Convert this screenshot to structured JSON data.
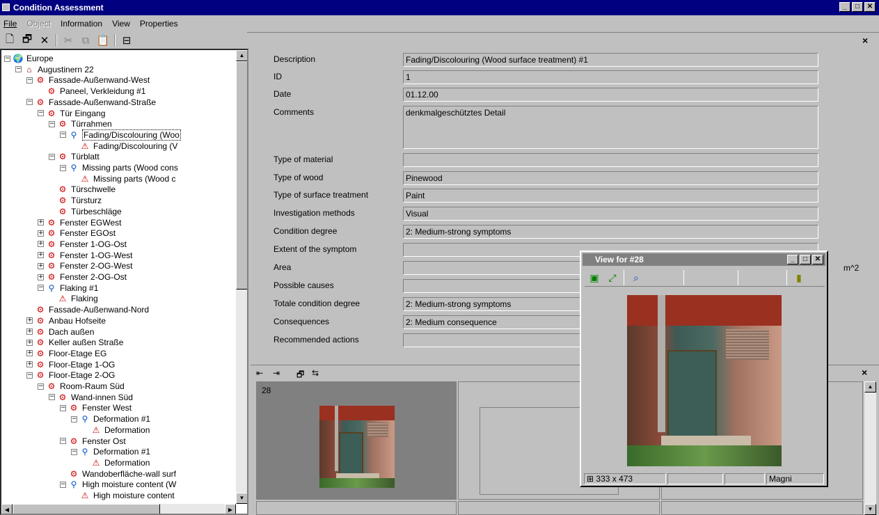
{
  "window": {
    "title": "Condition Assessment",
    "min": "_",
    "max": "□",
    "close": "✕"
  },
  "menu": {
    "file": "File",
    "object": "Object",
    "information": "Information",
    "view": "View",
    "properties": "Properties"
  },
  "tree": {
    "items": [
      {
        "label": "Europe",
        "ex": "−",
        "icon": "globe"
      },
      {
        "label": "Augustinern 22",
        "ex": "−",
        "icon": "house"
      },
      {
        "label": "Fassade-Außenwand-West",
        "ex": "−",
        "icon": "component"
      },
      {
        "label": "Paneel, Verkleidung #1",
        "ex": "",
        "icon": "component"
      },
      {
        "label": "Fassade-Außenwand-Straße",
        "ex": "−",
        "icon": "component"
      },
      {
        "label": "Tür Eingang",
        "ex": "−",
        "icon": "component"
      },
      {
        "label": "Türrahmen",
        "ex": "−",
        "icon": "component"
      },
      {
        "label": "Fading/Discolouring (Woo",
        "ex": "−",
        "icon": "magnifier"
      },
      {
        "label": "Fading/Discolouring (V",
        "ex": "",
        "icon": "warning"
      },
      {
        "label": "Türblatt",
        "ex": "−",
        "icon": "component"
      },
      {
        "label": "Missing parts (Wood cons",
        "ex": "−",
        "icon": "magnifier"
      },
      {
        "label": "Missing parts (Wood c",
        "ex": "",
        "icon": "warning"
      },
      {
        "label": "Türschwelle",
        "ex": "",
        "icon": "component"
      },
      {
        "label": "Türsturz",
        "ex": "",
        "icon": "component"
      },
      {
        "label": "Türbeschläge",
        "ex": "",
        "icon": "component"
      },
      {
        "label": "Fenster EGWest",
        "ex": "+",
        "icon": "component"
      },
      {
        "label": "Fenster EGOst",
        "ex": "+",
        "icon": "component"
      },
      {
        "label": "Fenster 1-OG-Ost",
        "ex": "+",
        "icon": "component"
      },
      {
        "label": "Fenster 1-OG-West",
        "ex": "+",
        "icon": "component"
      },
      {
        "label": "Fenster 2-OG-West",
        "ex": "+",
        "icon": "component"
      },
      {
        "label": "Fenster 2-OG-Ost",
        "ex": "+",
        "icon": "component"
      },
      {
        "label": "Flaking #1",
        "ex": "−",
        "icon": "magnifier"
      },
      {
        "label": "Flaking",
        "ex": "",
        "icon": "warning"
      },
      {
        "label": "Fassade-Außenwand-Nord",
        "ex": "",
        "icon": "component"
      },
      {
        "label": "Anbau Hofseite",
        "ex": "+",
        "icon": "component"
      },
      {
        "label": "Dach außen",
        "ex": "+",
        "icon": "component"
      },
      {
        "label": "Keller außen Straße",
        "ex": "+",
        "icon": "component"
      },
      {
        "label": "Floor-Etage EG",
        "ex": "+",
        "icon": "component"
      },
      {
        "label": "Floor-Etage 1-OG",
        "ex": "+",
        "icon": "component"
      },
      {
        "label": "Floor-Etage 2-OG",
        "ex": "−",
        "icon": "component"
      },
      {
        "label": "Room-Raum Süd",
        "ex": "−",
        "icon": "component"
      },
      {
        "label": "Wand-innen Süd",
        "ex": "−",
        "icon": "component"
      },
      {
        "label": "Fenster West",
        "ex": "−",
        "icon": "component"
      },
      {
        "label": "Deformation #1",
        "ex": "−",
        "icon": "magnifier"
      },
      {
        "label": "Deformation",
        "ex": "",
        "icon": "warning"
      },
      {
        "label": "Fenster Ost",
        "ex": "−",
        "icon": "component"
      },
      {
        "label": "Deformation #1",
        "ex": "−",
        "icon": "magnifier"
      },
      {
        "label": "Deformation",
        "ex": "",
        "icon": "warning"
      },
      {
        "label": "Wandoberfläche-wall surf",
        "ex": "",
        "icon": "component"
      },
      {
        "label": "High moisture content (W",
        "ex": "−",
        "icon": "magnifier"
      },
      {
        "label": "High moisture content",
        "ex": "",
        "icon": "warning"
      }
    ]
  },
  "form": {
    "fields": [
      {
        "label": "Description",
        "value": "Fading/Discolouring (Wood surface treatment) #1"
      },
      {
        "label": "ID",
        "value": "1"
      },
      {
        "label": "Date",
        "value": "01.12.00"
      },
      {
        "label": "Comments",
        "value": "denkmalgeschütztes Detail"
      },
      {
        "label": "Type of material",
        "value": ""
      },
      {
        "label": "Type of wood",
        "value": "Pinewood"
      },
      {
        "label": "Type of surface treatment",
        "value": "Paint"
      },
      {
        "label": "Investigation methods",
        "value": "Visual"
      },
      {
        "label": "Condition degree",
        "value": "2: Medium-strong symptoms"
      },
      {
        "label": "Extent of the symptom",
        "value": ""
      },
      {
        "label": "Area",
        "value": ""
      },
      {
        "label": "Possible causes",
        "value": ""
      },
      {
        "label": "Totale condition degree",
        "value": "2: Medium-strong symptoms"
      },
      {
        "label": "Consequences",
        "value": "2: Medium consequence"
      },
      {
        "label": "Recommended actions",
        "value": ""
      }
    ],
    "area_unit": "m^2"
  },
  "gallery": {
    "cell_number": "28"
  },
  "viewer": {
    "title": "View for #28",
    "dimensions": "333 x 473",
    "zoom_label": "Magni"
  },
  "colors": {
    "title_active": "#000080",
    "title_inactive": "#808080",
    "face": "#c0c0c0",
    "warning": "#cc0000"
  }
}
